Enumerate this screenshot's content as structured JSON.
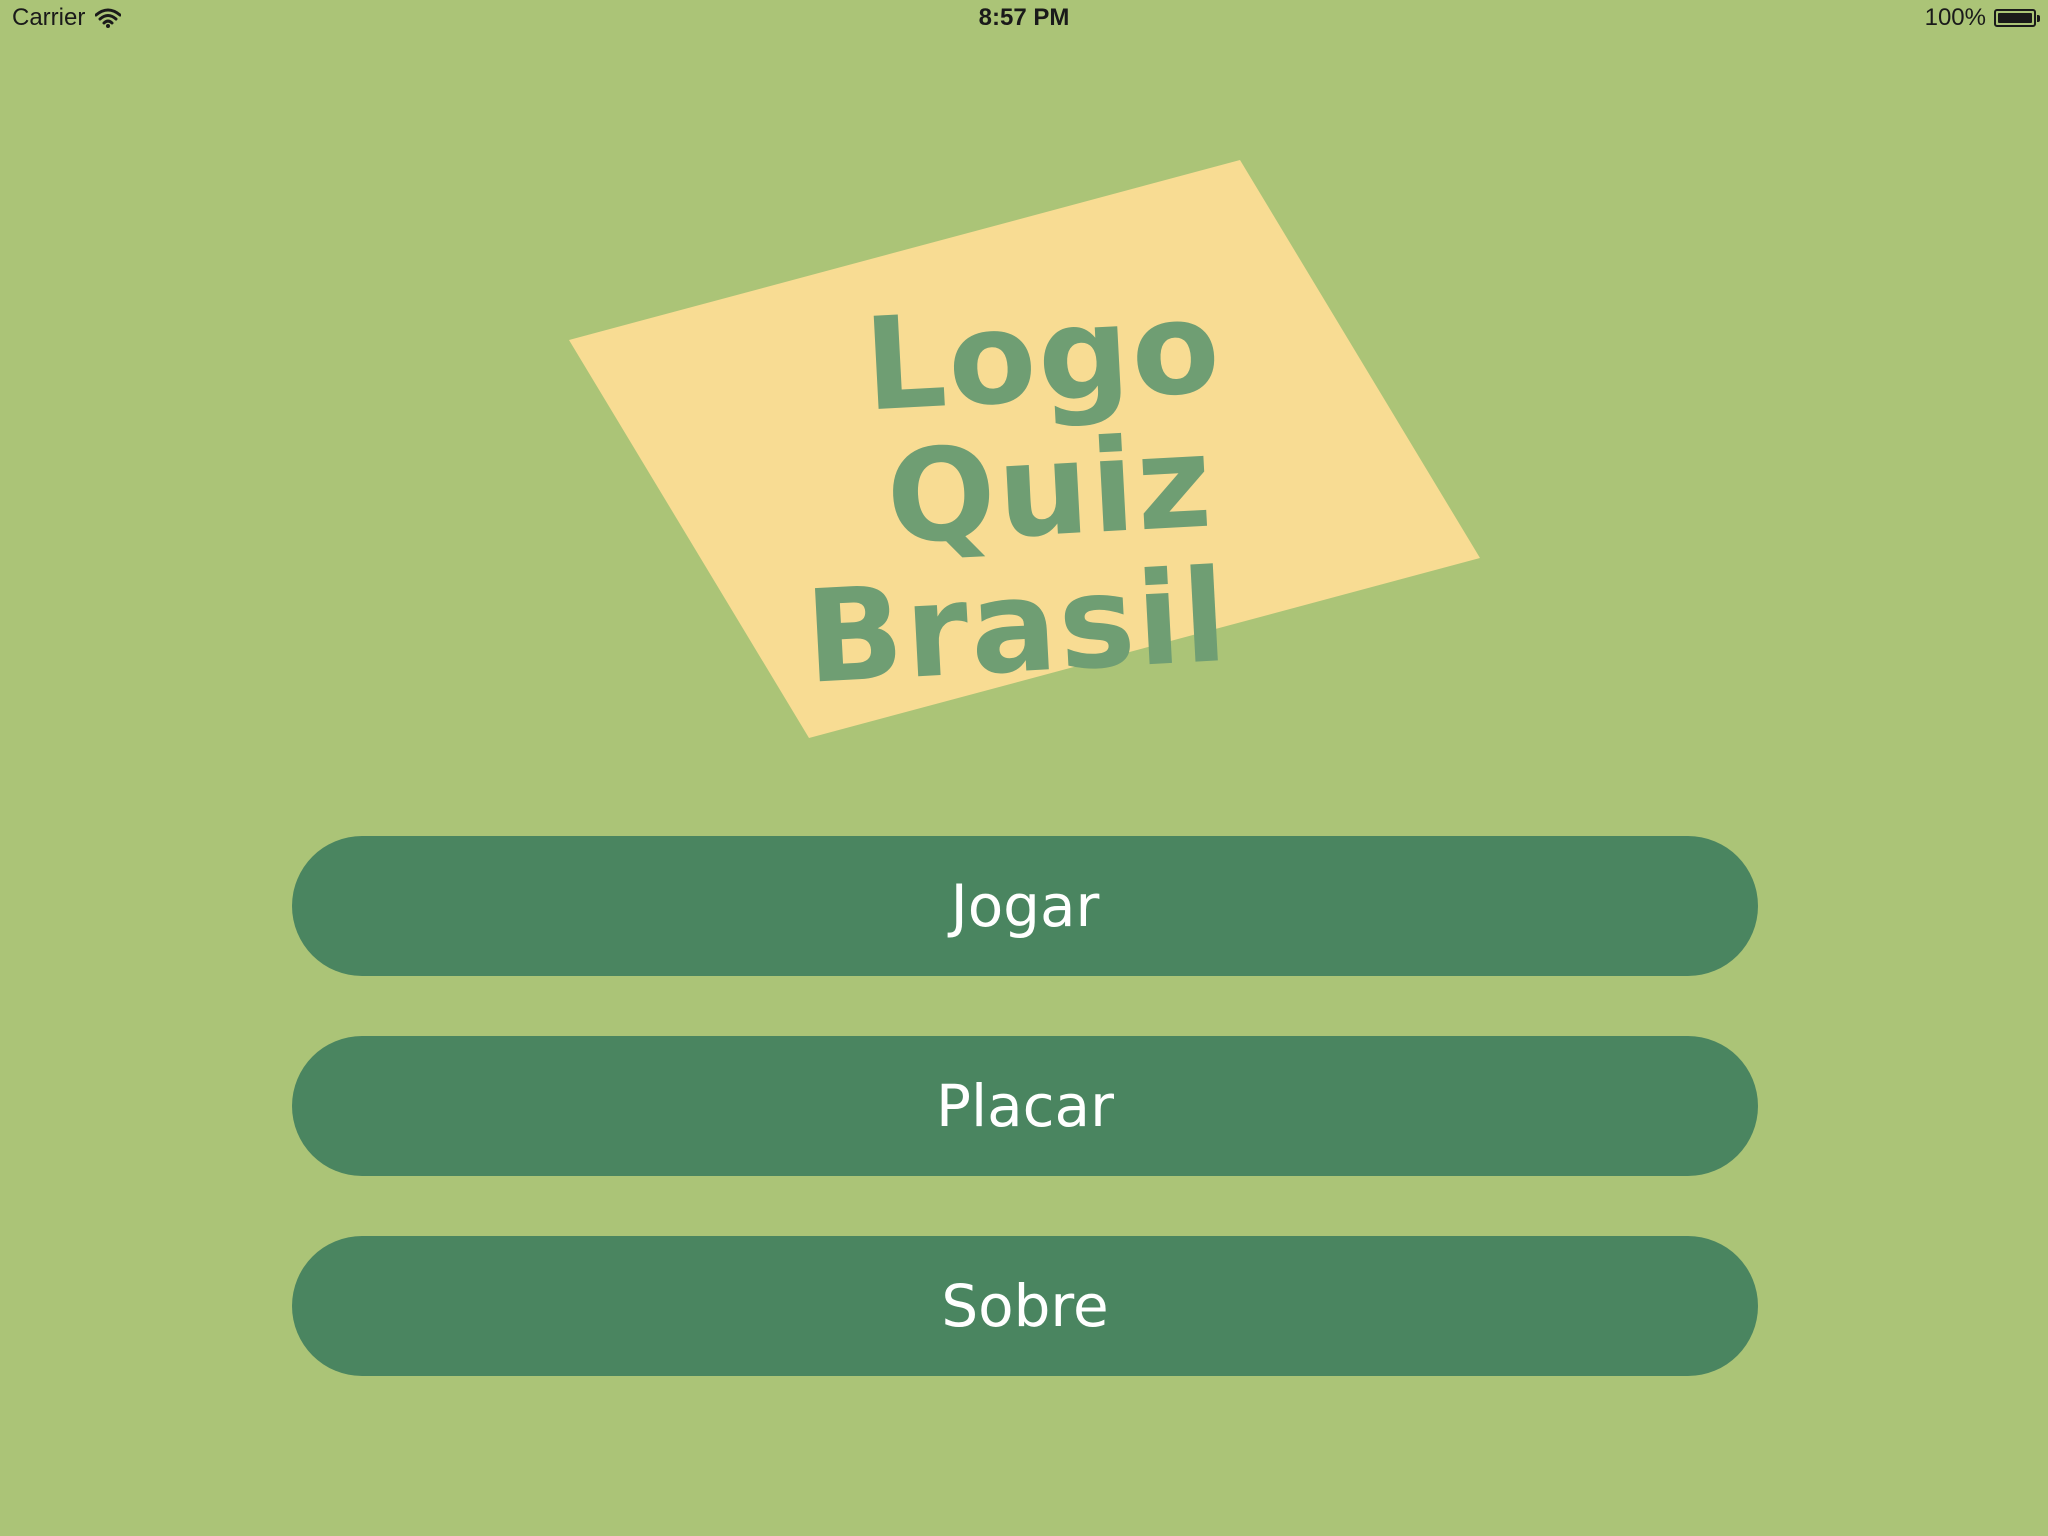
{
  "status_bar": {
    "carrier": "Carrier",
    "time": "8:57 PM",
    "battery": "100%",
    "battery_level": 1.0,
    "wifi_icon": "wifi-icon",
    "battery_icon": "battery-icon"
  },
  "logo": {
    "line1": "Logo Quiz",
    "line2": "Brasil",
    "card_color": "#f8dc93",
    "text_color": "#6f9e73"
  },
  "menu": {
    "play_label": "Jogar",
    "score_label": "Placar",
    "about_label": "Sobre"
  },
  "colors": {
    "background": "#abc477",
    "button": "#4a8560",
    "button_text": "#ffffff"
  }
}
